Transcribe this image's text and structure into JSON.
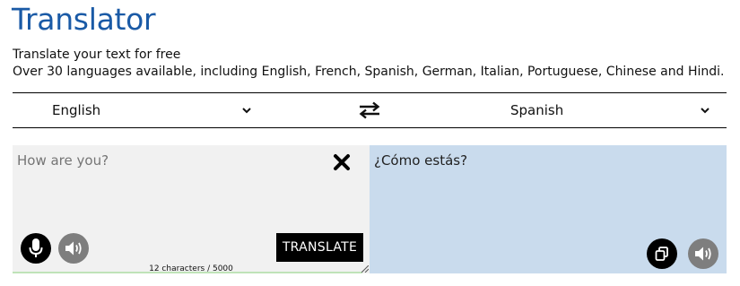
{
  "header": {
    "title": "Translator",
    "subtitle": "Translate your text for free",
    "description": "Over 30 languages available, including English, French, Spanish, German, Italian, Portuguese, Chinese and Hindi."
  },
  "languages": {
    "source": "English",
    "target": "Spanish",
    "swap_icon": "swap-arrows-icon",
    "dropdown_icon": "chevron-down-icon"
  },
  "source_panel": {
    "placeholder": "How are you?",
    "text": "",
    "clear_icon": "close-icon",
    "mic_icon": "microphone-icon",
    "speaker_icon": "speaker-icon",
    "translate_label": "TRANSLATE",
    "char_count": "12 characters / 5000",
    "char_fraction": 0.0024
  },
  "target_panel": {
    "text": "¿Cómo estás?",
    "copy_icon": "copy-icon",
    "speaker_icon": "speaker-icon"
  },
  "colors": {
    "title": "#1a5aa6",
    "source_bg": "#f1f1f1",
    "target_bg": "#c9dbed",
    "button_bg": "#000000",
    "speaker_bg": "#7e7e7e"
  }
}
